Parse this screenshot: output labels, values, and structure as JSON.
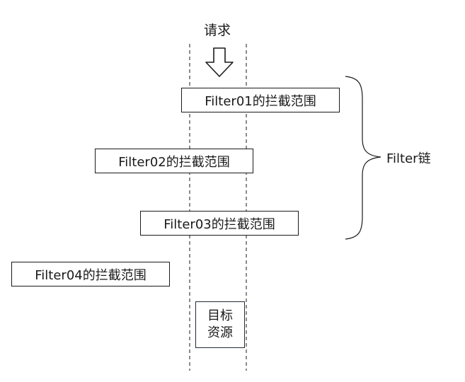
{
  "request_label": "请求",
  "filters": [
    {
      "label": "Filter01的拦截范围"
    },
    {
      "label": "Filter02的拦截范围"
    },
    {
      "label": "Filter03的拦截范围"
    },
    {
      "label": "Filter04的拦截范围"
    }
  ],
  "chain_label": "Filter链",
  "target": {
    "line1": "目标",
    "line2": "资源"
  }
}
